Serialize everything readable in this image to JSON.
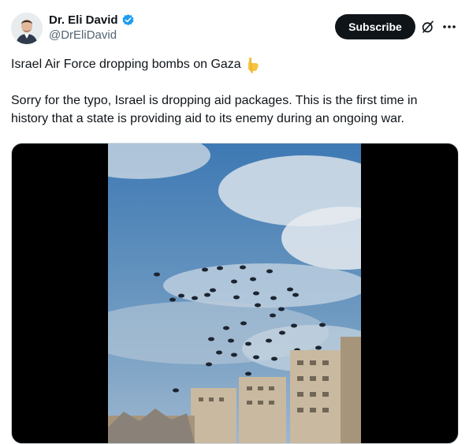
{
  "author": {
    "display_name": "Dr. Eli David",
    "handle": "@DrEliDavid",
    "avatar_icon": "avatar-photo",
    "verified_icon": "verified-badge-icon"
  },
  "actions": {
    "subscribe_label": "Subscribe",
    "grok_icon": "grok-icon",
    "more_icon": "more-options-icon"
  },
  "tweet": {
    "line1": "Israel Air Force dropping bombs on Gaza",
    "line1_emoji": "pointing-down-icon",
    "line2": "Sorry for the typo, Israel is dropping aid packages. This is the first time in history that a state is providing aid to its enemy during an ongoing war."
  },
  "media": {
    "type": "video",
    "subject": "parachute-aid-drop-over-city"
  },
  "colors": {
    "text": "#0f1419",
    "secondary_text": "#536471",
    "verified_blue": "#1d9bf0",
    "button_bg": "#0f1419",
    "emoji_yellow": "#f7c33f"
  }
}
